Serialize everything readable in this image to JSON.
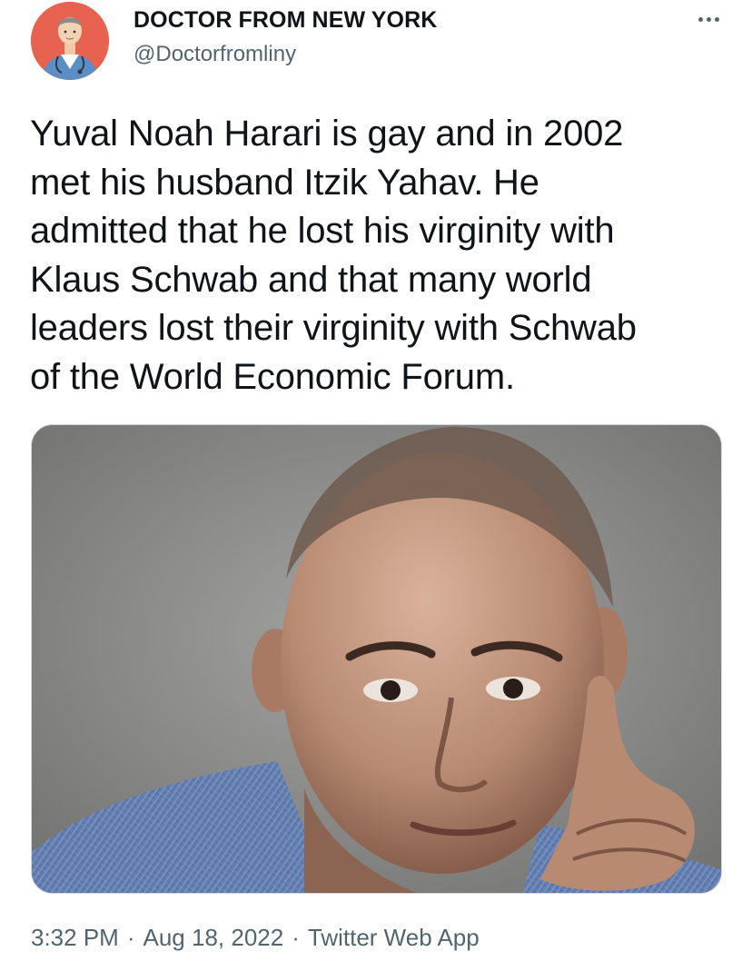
{
  "author": {
    "display_name": "DOCTOR FROM NEW YORK",
    "handle": "@Doctorfromliny",
    "avatar_icon": "doctor-avatar"
  },
  "more_icon": "more-horizontal-icon",
  "tweet": {
    "lines": [
      "Yuval Noah Harari is gay and in 2002",
      "met his husband Itzik Yahav. He",
      "admitted that he lost his virginity with",
      "Klaus Schwab and that many world",
      "leaders lost their virginity with Schwab",
      "of the World Economic Forum."
    ]
  },
  "meta": {
    "time": "3:32 PM",
    "date": "Aug 18, 2022",
    "separator": "·",
    "source": "Twitter Web App"
  },
  "colors": {
    "text_primary": "#0f1419",
    "text_secondary": "#536471",
    "avatar_bg": "#e8634f",
    "media_border": "#cfd9de"
  }
}
